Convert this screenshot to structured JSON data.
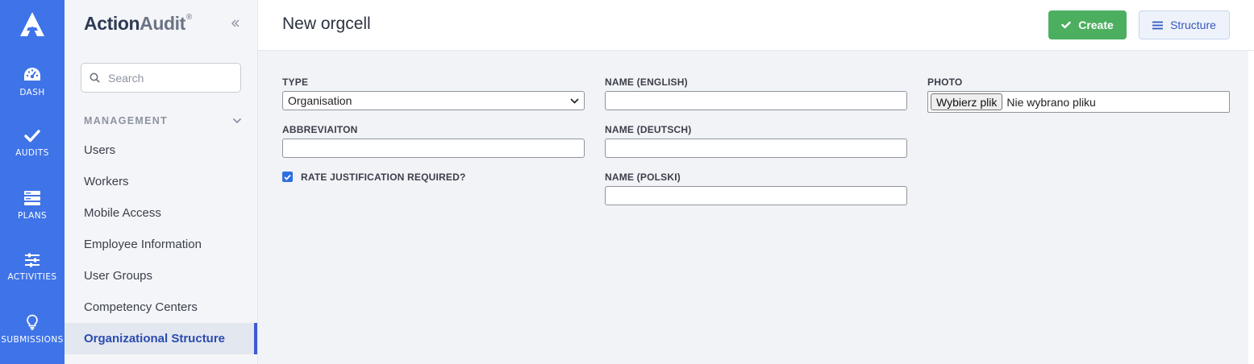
{
  "app": {
    "brand_action": "Action",
    "brand_audit": "Audit",
    "brand_mark": "®"
  },
  "rail": {
    "items": [
      {
        "label": "DASH",
        "icon": "dashboard-gauge-icon"
      },
      {
        "label": "AUDITS",
        "icon": "checkmark-icon"
      },
      {
        "label": "PLANS",
        "icon": "plans-list-icon"
      },
      {
        "label": "ACTIVITIES",
        "icon": "sliders-icon"
      },
      {
        "label": "SUBMISSIONS",
        "icon": "lightbulb-icon"
      }
    ]
  },
  "sidebar": {
    "search_placeholder": "Search",
    "section_title": "MANAGEMENT",
    "items": [
      {
        "label": "Users"
      },
      {
        "label": "Workers"
      },
      {
        "label": "Mobile Access"
      },
      {
        "label": "Employee Information"
      },
      {
        "label": "User Groups"
      },
      {
        "label": "Competency Centers"
      },
      {
        "label": "Organizational Structure",
        "active": true
      }
    ]
  },
  "header": {
    "title": "New orgcell",
    "create_label": "Create",
    "structure_label": "Structure"
  },
  "form": {
    "type_label": "TYPE",
    "type_value": "Organisation",
    "abbreviation_label": "ABBREVIAITON",
    "abbreviation_value": "",
    "rate_label": "RATE JUSTIFICATION REQUIRED?",
    "rate_checked": true,
    "name_en_label": "NAME (ENGLISH)",
    "name_en_value": "",
    "name_de_label": "NAME (DEUTSCH)",
    "name_de_value": "",
    "name_pl_label": "NAME (POLSKI)",
    "name_pl_value": "",
    "photo_label": "PHOTO",
    "photo_button": "Wybierz plik",
    "photo_status": "Nie wybrano pliku"
  },
  "colors": {
    "rail": "#3f73e8",
    "create": "#4caf5f",
    "accent": "#3d5bd0"
  }
}
